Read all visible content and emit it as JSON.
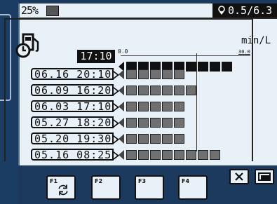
{
  "status_bar": {
    "fuel_percent": "25%",
    "hourmeter": "0.5/6.3"
  },
  "chart_data": {
    "type": "bar",
    "unit": "min/L",
    "scale_min_label": "0.0",
    "scale_max_label": "30.0",
    "current_label": "17:10",
    "current_value": 9,
    "history": [
      {
        "label": "06.16 20:10",
        "value": 5
      },
      {
        "label": "06.09 16:20",
        "value": 6
      },
      {
        "label": "06.03 17:10",
        "value": 5
      },
      {
        "label": "05.27 18:20",
        "value": 5
      },
      {
        "label": "05.20 19:30",
        "value": 5
      },
      {
        "label": "05.16 08:25",
        "value": 8
      }
    ]
  },
  "function_keys": [
    {
      "label": "F1",
      "icon": "refresh-icon"
    },
    {
      "label": "F2"
    },
    {
      "label": "F3"
    },
    {
      "label": "F4"
    }
  ],
  "aux_keys": [
    {
      "icon": "close-icon"
    },
    {
      "icon": "return-icon"
    }
  ]
}
